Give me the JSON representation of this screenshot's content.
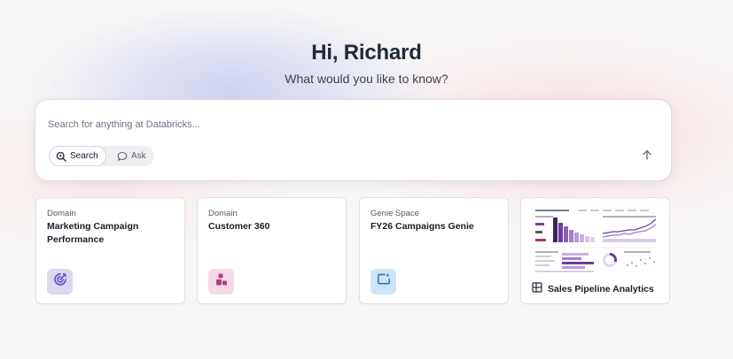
{
  "greeting": "Hi, Richard",
  "subtitle": "What would you like to know?",
  "search": {
    "placeholder": "Search for anything at Databricks...",
    "value": "",
    "modes": [
      {
        "label": "Search",
        "icon": "search-sparkle-icon",
        "active": true
      },
      {
        "label": "Ask",
        "icon": "chat-bubble-icon",
        "active": false
      }
    ],
    "send_icon": "arrow-up-icon"
  },
  "cards": [
    {
      "kind": "Domain",
      "title": "Marketing Campaign Performance",
      "icon": "target-icon",
      "badge_color": "#dcd8ee"
    },
    {
      "kind": "Domain",
      "title": "Customer 360",
      "icon": "user-segments-icon",
      "badge_color": "#f6d9e6"
    },
    {
      "kind": "Genie Space",
      "title": "FY26 Campaigns Genie",
      "icon": "chat-sparkle-icon",
      "badge_color": "#cfe4f4"
    },
    {
      "kind": "",
      "title": "Sales Pipeline Analytics",
      "icon": "dashboard-icon",
      "thumbnail": "dashboard-thumbnail"
    }
  ],
  "colors": {
    "accent_violet": "#6e56cf",
    "accent_pink": "#b0407a",
    "accent_blue": "#2f7cb8"
  }
}
